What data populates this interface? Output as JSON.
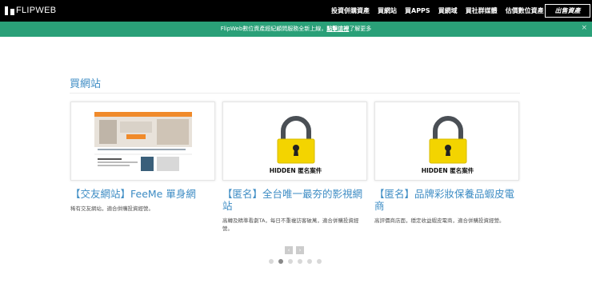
{
  "header": {
    "logo_text": "FLIPWEB",
    "nav": [
      "投資併購資產",
      "買網站",
      "買APPS",
      "買網域",
      "買社群媒體",
      "估價數位資產"
    ],
    "sell_button": "出售資產"
  },
  "banner": {
    "text_before": "FlipWeb數位資產經紀顧問服務全新上線，",
    "link": "點擊這裡",
    "text_after": "了解更多",
    "close": "×"
  },
  "section": {
    "title": "買網站"
  },
  "cards": [
    {
      "title": "【交友網站】FeeMe 單身網",
      "desc": "稀有交友網站，適合併購投資經營。",
      "thumb": "screenshot"
    },
    {
      "title": "【匿名】全台唯一最夯的影視網站",
      "desc": "高轉及精準看劇TA，每日不重複訪客破萬，適合併購投資經營。",
      "thumb": "lock",
      "hidden_label": "HIDDEN 匿名案件"
    },
    {
      "title": "【匿名】品牌彩妝保養品蝦皮電商",
      "desc": "高評價商店面，穩定收益蝦皮電商，適合併購投資經營。",
      "thumb": "lock",
      "hidden_label": "HIDDEN 匿名案件"
    }
  ],
  "pager": {
    "prev": "‹",
    "next": "›",
    "dots": 6,
    "active_dot": 1
  },
  "colors": {
    "accent": "#3d8cc4",
    "banner": "#2aa078",
    "nav_bg": "#000000",
    "lock_yellow": "#f3d400"
  }
}
